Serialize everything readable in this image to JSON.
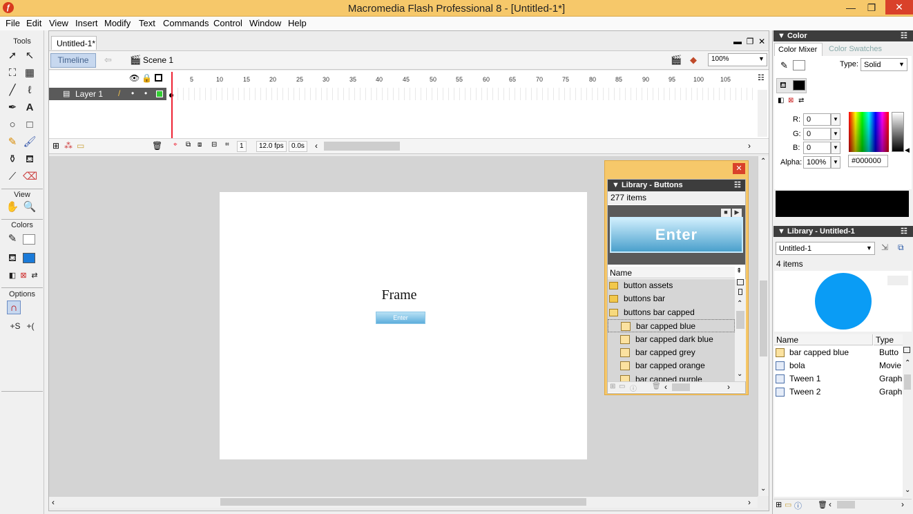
{
  "window": {
    "title": "Macromedia Flash Professional 8 - [Untitled-1*]",
    "controls": {
      "minimize": "—",
      "restore": "❐",
      "close": "✕"
    }
  },
  "menu": [
    "File",
    "Edit",
    "View",
    "Insert",
    "Modify",
    "Text",
    "Commands",
    "Control",
    "Window",
    "Help"
  ],
  "tools": {
    "label": "Tools",
    "view_label": "View",
    "colors_label": "Colors",
    "options_label": "Options"
  },
  "document": {
    "tab": "Untitled-1*",
    "timeline_button": "Timeline",
    "scene": "Scene 1",
    "zoom": "100%"
  },
  "timeline": {
    "layer_name": "Layer 1",
    "ruler": [
      "5",
      "10",
      "15",
      "20",
      "25",
      "30",
      "35",
      "40",
      "45",
      "50",
      "55",
      "60",
      "65",
      "70",
      "75",
      "80",
      "85",
      "90",
      "95",
      "100",
      "105"
    ],
    "current_frame": "1",
    "fps": "12.0 fps",
    "elapsed": "0.0s"
  },
  "stage": {
    "frame_text": "Frame",
    "button_text": "Enter"
  },
  "library_buttons": {
    "title": "Library - Buttons",
    "count": "277 items",
    "preview_text": "Enter",
    "name_header": "Name",
    "items": [
      {
        "label": "button assets",
        "kind": "folder"
      },
      {
        "label": "buttons bar",
        "kind": "folder"
      },
      {
        "label": "buttons bar capped",
        "kind": "folder-open"
      },
      {
        "label": "bar capped blue",
        "kind": "button"
      },
      {
        "label": "bar capped dark blue",
        "kind": "button"
      },
      {
        "label": "bar capped grey",
        "kind": "button"
      },
      {
        "label": "bar capped orange",
        "kind": "button"
      },
      {
        "label": "bar capped purple",
        "kind": "button"
      }
    ]
  },
  "color_panel": {
    "title": "Color",
    "tab_mixer": "Color Mixer",
    "tab_swatches": "Color Swatches",
    "type_label": "Type:",
    "type_value": "Solid",
    "r_label": "R:",
    "r": "0",
    "g_label": "G:",
    "g": "0",
    "b_label": "B:",
    "b": "0",
    "alpha_label": "Alpha:",
    "alpha": "100%",
    "hex": "#000000"
  },
  "library_doc": {
    "title": "Library - Untitled-1",
    "document": "Untitled-1",
    "count": "4 items",
    "name_header": "Name",
    "type_header": "Type",
    "items": [
      {
        "name": "bar capped blue",
        "type": "Butto"
      },
      {
        "name": "bola",
        "type": "Movie"
      },
      {
        "name": "Tween 1",
        "type": "Graph"
      },
      {
        "name": "Tween 2",
        "type": "Graph"
      }
    ]
  },
  "colors": {
    "accent": "#f6c86a",
    "close_red": "#d9412a",
    "library_circle": "#0a9cf5",
    "fill_swatch": "#1a7ad8"
  },
  "icons": {
    "arrow": "arrow-icon",
    "subselect": "subselect-icon",
    "hand": "hand-icon",
    "zoom": "zoom-icon"
  }
}
